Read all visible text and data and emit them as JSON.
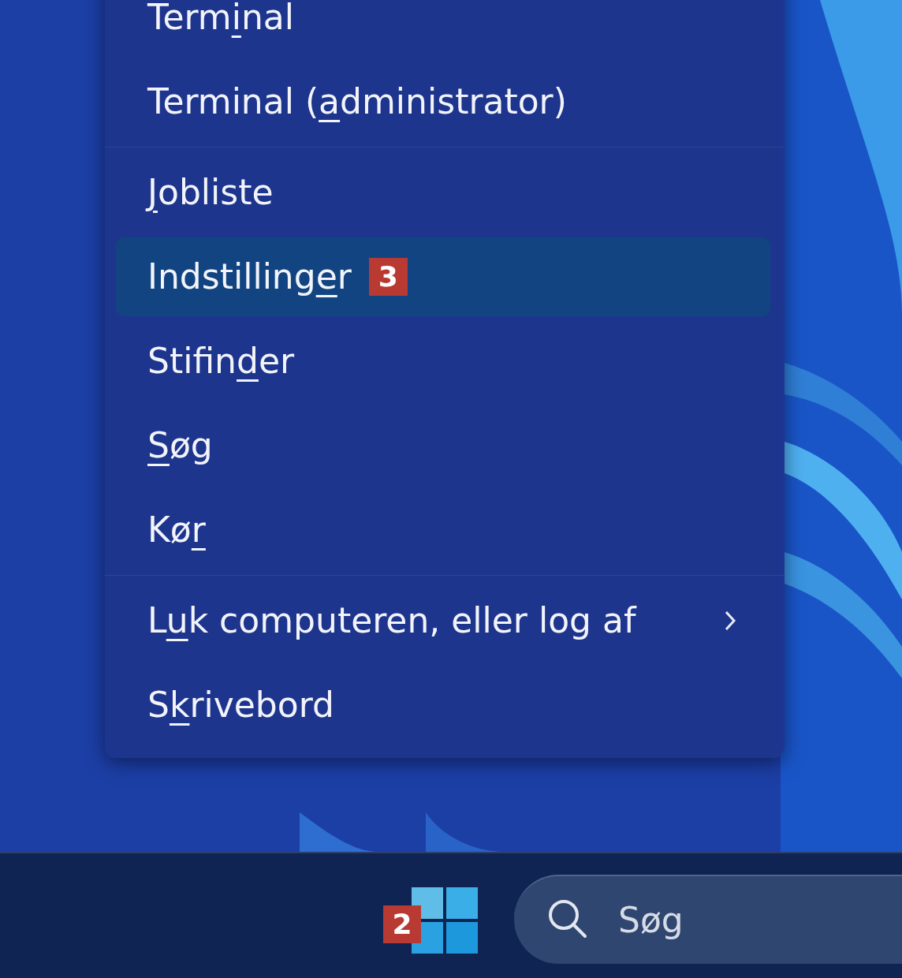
{
  "menu": {
    "groups": [
      {
        "items": [
          {
            "label_before": "Term",
            "access_key": "i",
            "label_after": "nal",
            "selected": false,
            "has_submenu": false
          },
          {
            "label_before": "Terminal (",
            "access_key": "a",
            "label_after": "dministrator)",
            "selected": false,
            "has_submenu": false
          }
        ]
      },
      {
        "items": [
          {
            "access_key": "J",
            "label_after": "obliste",
            "selected": false,
            "has_submenu": false
          },
          {
            "label_before": "Indstilling",
            "access_key": "e",
            "label_after": "r",
            "selected": true,
            "has_submenu": false,
            "badge": "3"
          },
          {
            "label_before": "Stifin",
            "access_key": "d",
            "label_after": "er",
            "selected": false,
            "has_submenu": false
          },
          {
            "access_key": "S",
            "label_after": "øg",
            "selected": false,
            "has_submenu": false
          },
          {
            "label_before": "Kø",
            "access_key": "r",
            "selected": false,
            "has_submenu": false
          }
        ]
      },
      {
        "items": [
          {
            "label_before": "L",
            "access_key": "u",
            "label_after": "k computeren, eller log af",
            "selected": false,
            "has_submenu": true
          },
          {
            "label_before": "S",
            "access_key": "k",
            "label_after": "rivebord",
            "selected": false,
            "has_submenu": false
          }
        ]
      }
    ]
  },
  "taskbar": {
    "start_badge": "2",
    "search": {
      "placeholder": "Søg"
    }
  }
}
